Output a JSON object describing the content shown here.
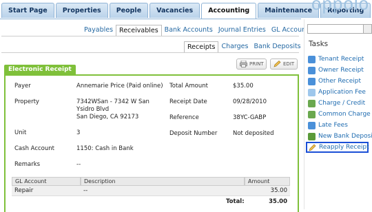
{
  "tabs": [
    "Start Page",
    "Properties",
    "People",
    "Vacancies",
    "Accounting",
    "Maintenance",
    "Reporting"
  ],
  "active_tab": "Accounting",
  "logo_text": "oppolo",
  "subnav": [
    "Payables",
    "Receivables",
    "Bank Accounts",
    "Journal Entries",
    "GL Accounts"
  ],
  "subnav_active": "Receivables",
  "subnav2": [
    "Receipts",
    "Charges",
    "Bank Deposits"
  ],
  "subnav2_active": "Receipts",
  "buttons": {
    "print": "PRINT",
    "edit": "EDIT"
  },
  "card_title": "Electronic Receipt",
  "fields": {
    "payer_label": "Payer",
    "payer_value": "Annemarie Price (Paid online)",
    "property_label": "Property",
    "property_line1": "7342WSan - 7342 W San",
    "property_line2": "Ysidro Blvd",
    "property_line3": "San Diego, CA 92173",
    "unit_label": "Unit",
    "unit_value": "3",
    "cash_account_label": "Cash Account",
    "cash_account_value": "1150: Cash in Bank",
    "remarks_label": "Remarks",
    "remarks_value": "--",
    "total_amount_label": "Total Amount",
    "total_amount_value": "$35.00",
    "receipt_date_label": "Receipt Date",
    "receipt_date_value": "09/28/2010",
    "reference_label": "Reference",
    "reference_value": "38YC-GABP",
    "deposit_number_label": "Deposit Number",
    "deposit_number_value": "Not deposited"
  },
  "table": {
    "headers": [
      "GL Account",
      "Description",
      "Amount"
    ],
    "rows": [
      {
        "gl": "Repair",
        "description": "--",
        "amount": "35.00"
      }
    ],
    "total_label": "Total:",
    "total_value": "35.00"
  },
  "sidebar": {
    "tasks_title": "Tasks",
    "tasks": [
      "Tenant Receipt",
      "Owner Receipt",
      "Other Receipt",
      "Application Fee",
      "Charge / Credit",
      "Common Charge",
      "Late Fees",
      "New Bank Deposit",
      "Reapply Receipt"
    ],
    "highlighted_task": "Reapply Receipt"
  },
  "colors": {
    "accent_green": "#7fc03a",
    "link_blue": "#1e6bb0",
    "highlight": "#1a4fd6"
  }
}
